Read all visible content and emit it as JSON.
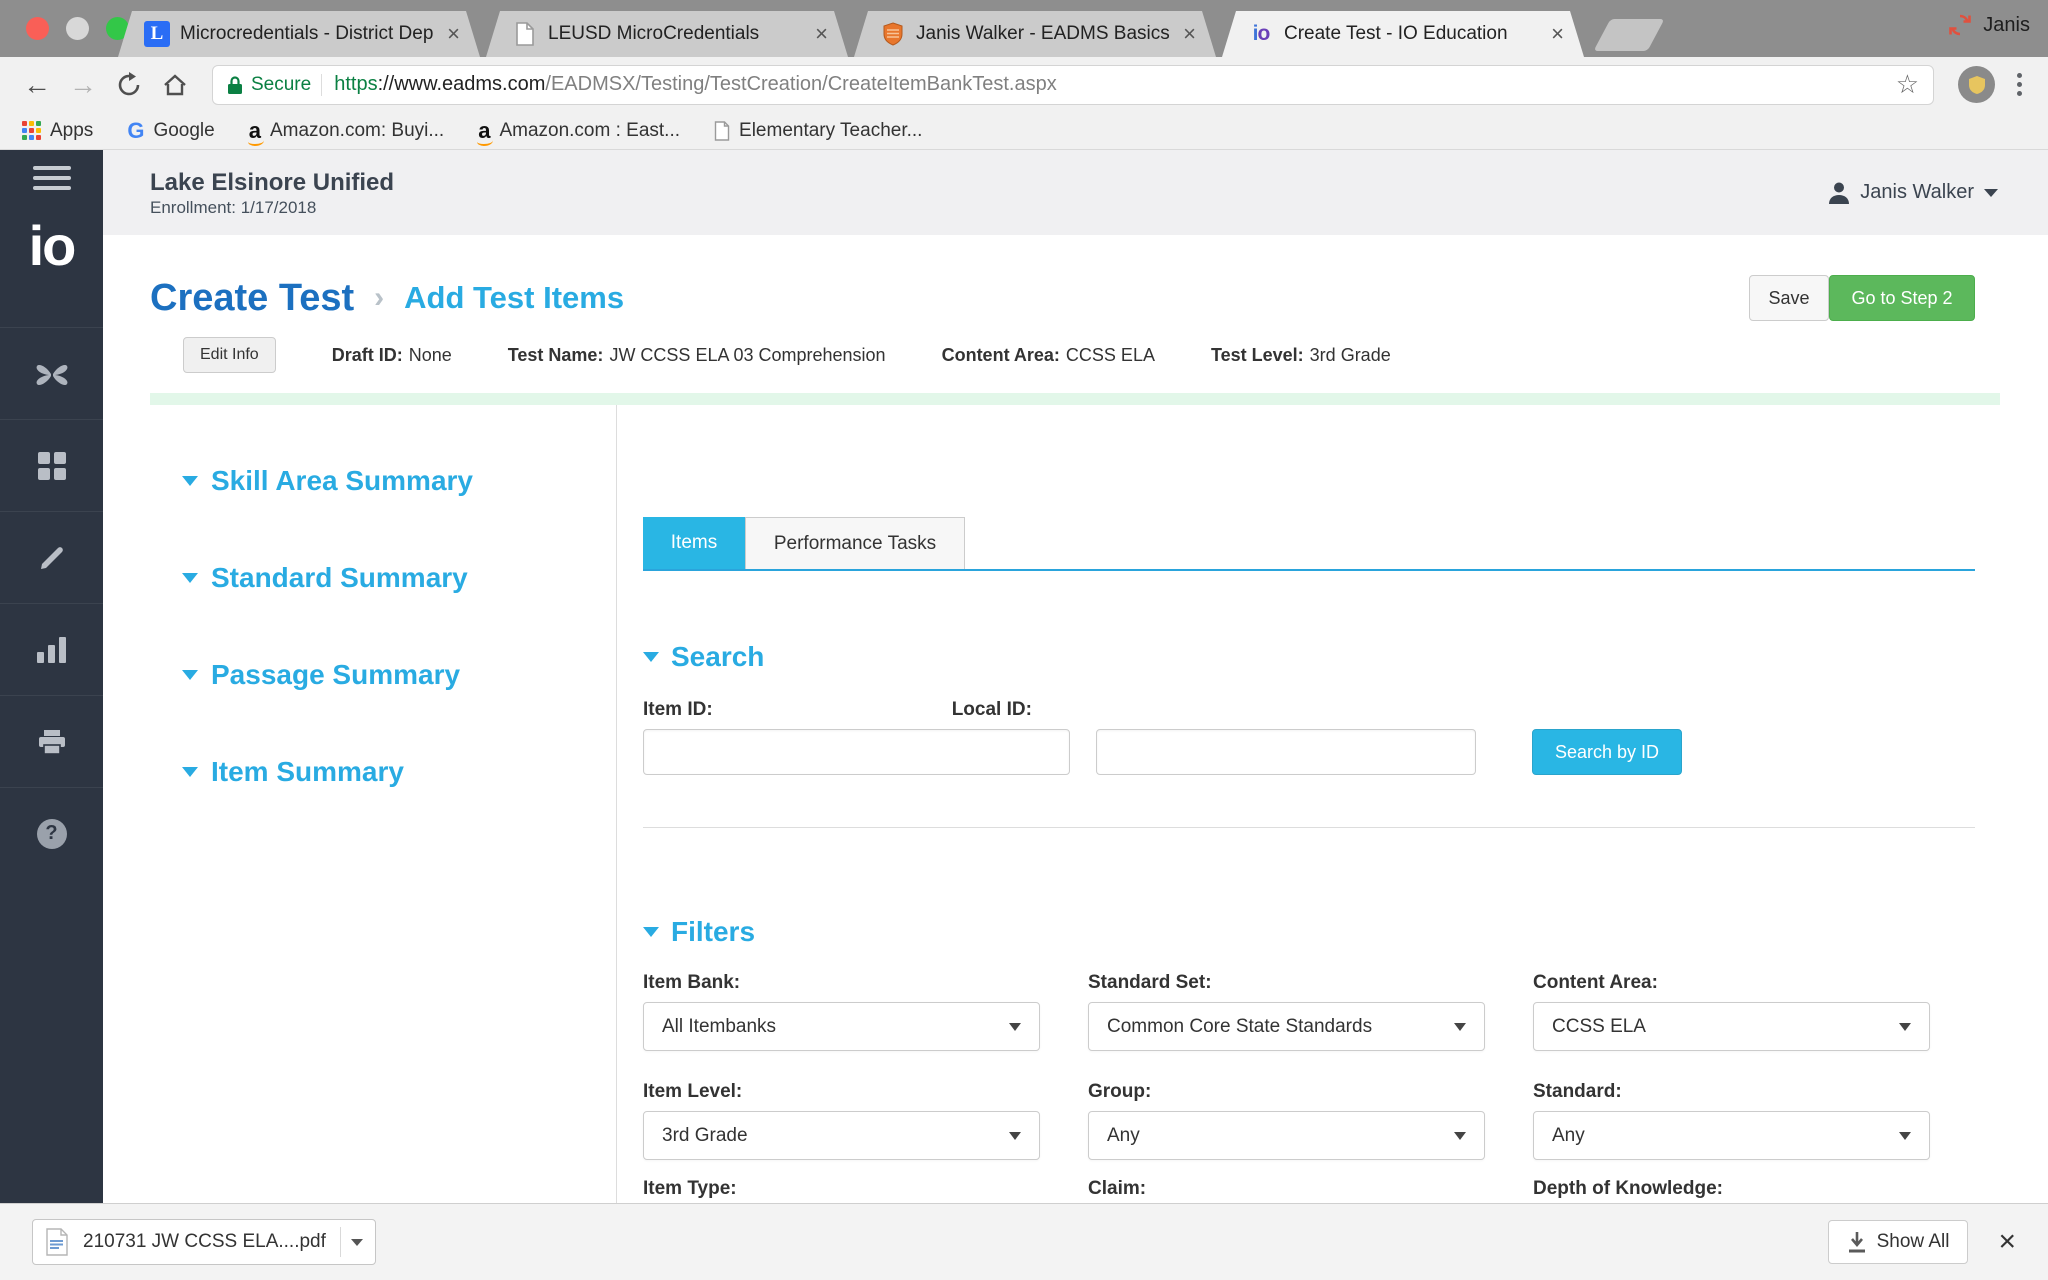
{
  "browser": {
    "tabs": [
      {
        "title": "Microcredentials - District Dep",
        "favicon": "letter-l"
      },
      {
        "title": "LEUSD MicroCredentials",
        "favicon": "document"
      },
      {
        "title": "Janis Walker - EADMS Basics",
        "favicon": "orange-shield"
      },
      {
        "title": "Create Test - IO Education",
        "favicon": "io-logo",
        "active": true
      }
    ],
    "profile_name": "Janis",
    "address": {
      "secure_label": "Secure",
      "scheme": "https",
      "host": "://www.eadms.com",
      "path": "/EADMSX/Testing/TestCreation/CreateItemBankTest.aspx"
    },
    "bookmarks": [
      {
        "label": "Apps"
      },
      {
        "label": "Google"
      },
      {
        "label": "Amazon.com: Buyi..."
      },
      {
        "label": "Amazon.com : East..."
      },
      {
        "label": "Elementary Teacher..."
      }
    ]
  },
  "site": {
    "district": "Lake Elsinore Unified",
    "enrollment": "Enrollment: 1/17/2018",
    "user": "Janis Walker",
    "logo": "io"
  },
  "page": {
    "title": "Create Test",
    "breadcrumb_separator": "›",
    "subtitle": "Add Test Items",
    "save_button": "Save",
    "step_button": "Go to Step 2",
    "edit_info_button": "Edit Info",
    "meta": [
      {
        "label": "Draft ID:",
        "value": "None"
      },
      {
        "label": "Test Name:",
        "value": "JW CCSS ELA 03 Comprehension"
      },
      {
        "label": "Content Area:",
        "value": "CCSS ELA"
      },
      {
        "label": "Test Level:",
        "value": "3rd Grade"
      }
    ],
    "summaries": [
      {
        "label": "Skill Area Summary"
      },
      {
        "label": "Standard Summary"
      },
      {
        "label": "Passage Summary"
      },
      {
        "label": "Item Summary"
      }
    ],
    "content_tabs": [
      {
        "label": "Items",
        "active": true
      },
      {
        "label": "Performance Tasks",
        "active": false
      }
    ],
    "search": {
      "heading": "Search",
      "item_id_label": "Item ID:",
      "item_id_value": "",
      "local_id_label": "Local ID:",
      "local_id_value": "",
      "button": "Search by ID"
    },
    "filters": {
      "heading": "Filters",
      "row1": [
        {
          "label": "Item Bank:",
          "value": "All Itembanks"
        },
        {
          "label": "Standard Set:",
          "value": "Common Core State Standards"
        },
        {
          "label": "Content Area:",
          "value": "CCSS ELA"
        }
      ],
      "row2": [
        {
          "label": "Item Level:",
          "value": "3rd Grade"
        },
        {
          "label": "Group:",
          "value": "Any"
        },
        {
          "label": "Standard:",
          "value": "Any"
        }
      ],
      "row3": [
        {
          "label": "Item Type:"
        },
        {
          "label": "Claim:"
        },
        {
          "label": "Depth of Knowledge:"
        }
      ]
    }
  },
  "download_bar": {
    "file_name": "210731 JW CCSS ELA....pdf",
    "show_all_button": "Show All"
  },
  "colors": {
    "accent_cyan": "#29abe2",
    "title_blue": "#1c70c0",
    "success_green": "#5cb85c",
    "sidebar_dark": "#2d3542",
    "secure_green": "#0b8043",
    "pale_green_bar": "#e2f7e9"
  }
}
